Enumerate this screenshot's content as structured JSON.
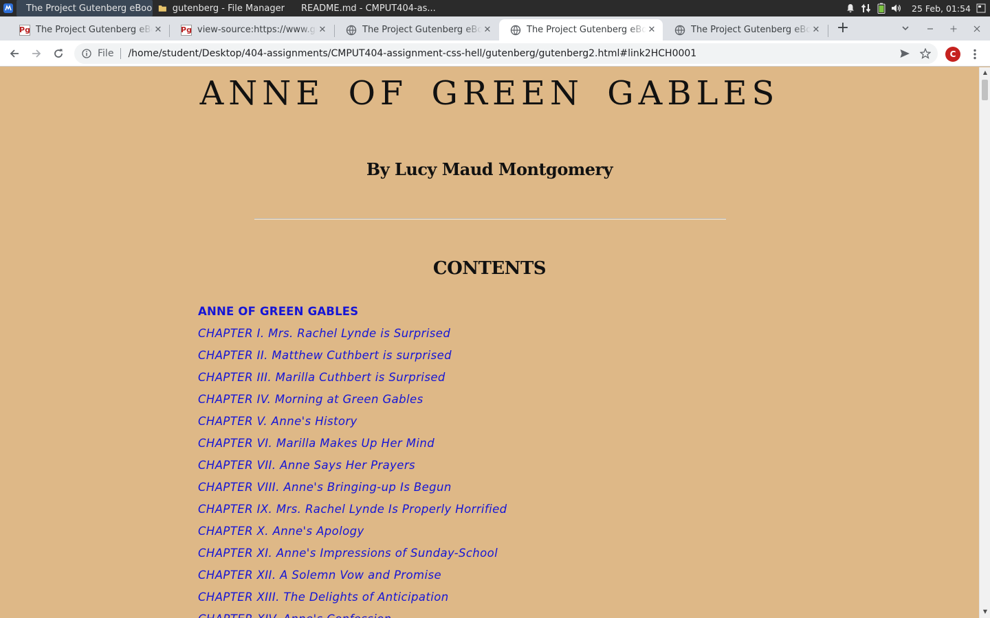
{
  "taskbar": {
    "tasks": [
      {
        "label": "The Project Gutenberg eBoo...",
        "icon": "chrome-icon",
        "active": true
      },
      {
        "label": "gutenberg - File Manager",
        "icon": "folder-icon",
        "active": false
      },
      {
        "label": "README.md - CMPUT404-as...",
        "icon": "vscode-icon",
        "active": false
      }
    ],
    "clock": "25 Feb, 01:54"
  },
  "browser": {
    "tabs": [
      {
        "title": "The Project Gutenberg eBook of",
        "favicon": "gutenberg-icon",
        "active": false
      },
      {
        "title": "view-source:https://www.gutenb",
        "favicon": "gutenberg-icon",
        "active": false
      },
      {
        "title": "The Project Gutenberg eBook of",
        "favicon": "globe-icon",
        "active": false
      },
      {
        "title": "The Project Gutenberg eBook of",
        "favicon": "globe-icon",
        "active": true
      },
      {
        "title": "The Project Gutenberg eBook of",
        "favicon": "globe-icon",
        "active": false
      }
    ],
    "address": {
      "scheme_label": "File",
      "url": "/home/student/Desktop/404-assignments/CMPUT404-assignment-css-hell/gutenberg/gutenberg2.html#link2HCH0001"
    },
    "profile_initial": "C"
  },
  "page": {
    "title": "ANNE OF GREEN GABLES",
    "author": "By Lucy Maud Montgomery",
    "contents_heading": "CONTENTS",
    "toc": [
      "ANNE OF GREEN GABLES",
      "CHAPTER I. Mrs. Rachel Lynde is Surprised",
      "CHAPTER II. Matthew Cuthbert is surprised",
      "CHAPTER III. Marilla Cuthbert is Surprised",
      "CHAPTER IV. Morning at Green Gables",
      "CHAPTER V. Anne's History",
      "CHAPTER VI. Marilla Makes Up Her Mind",
      "CHAPTER VII. Anne Says Her Prayers",
      "CHAPTER VIII. Anne's Bringing-up Is Begun",
      "CHAPTER IX. Mrs. Rachel Lynde Is Properly Horrified",
      "CHAPTER X. Anne's Apology",
      "CHAPTER XI. Anne's Impressions of Sunday-School",
      "CHAPTER XII. A Solemn Vow and Promise",
      "CHAPTER XIII. The Delights of Anticipation",
      "CHAPTER XIV. Anne's Confession"
    ]
  },
  "colors": {
    "page_background": "#deb887",
    "link": "#1515d6"
  }
}
